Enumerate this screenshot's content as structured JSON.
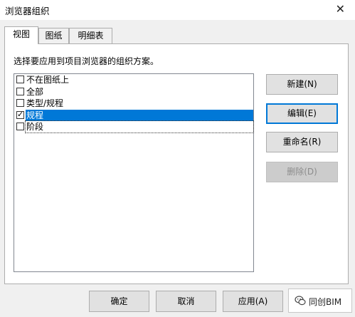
{
  "window": {
    "title": "浏览器组织",
    "close_glyph": "✕"
  },
  "tabs": [
    {
      "label": "视图",
      "active": true
    },
    {
      "label": "图纸",
      "active": false
    },
    {
      "label": "明细表",
      "active": false
    }
  ],
  "instruction": "选择要应用到项目浏览器的组织方案。",
  "schemes": [
    {
      "label": "不在图纸上",
      "checked": false,
      "selected": false
    },
    {
      "label": "全部",
      "checked": false,
      "selected": false
    },
    {
      "label": "类型/规程",
      "checked": false,
      "selected": false
    },
    {
      "label": "规程",
      "checked": true,
      "selected": true
    },
    {
      "label": "阶段",
      "checked": false,
      "selected": false,
      "focused": true
    }
  ],
  "side_buttons": {
    "new": "新建(N)",
    "edit": "编辑(E)",
    "rename": "重命名(R)",
    "delete": "删除(D)"
  },
  "bottom_buttons": {
    "ok": "确定",
    "cancel": "取消",
    "apply": "应用(A)"
  },
  "watermark": {
    "text": "同创BIM",
    "icon": "wechat-icon"
  },
  "colors": {
    "selection": "#0078d7",
    "dialog_bg": "#f0f0f0",
    "button_bg": "#e1e1e1"
  }
}
